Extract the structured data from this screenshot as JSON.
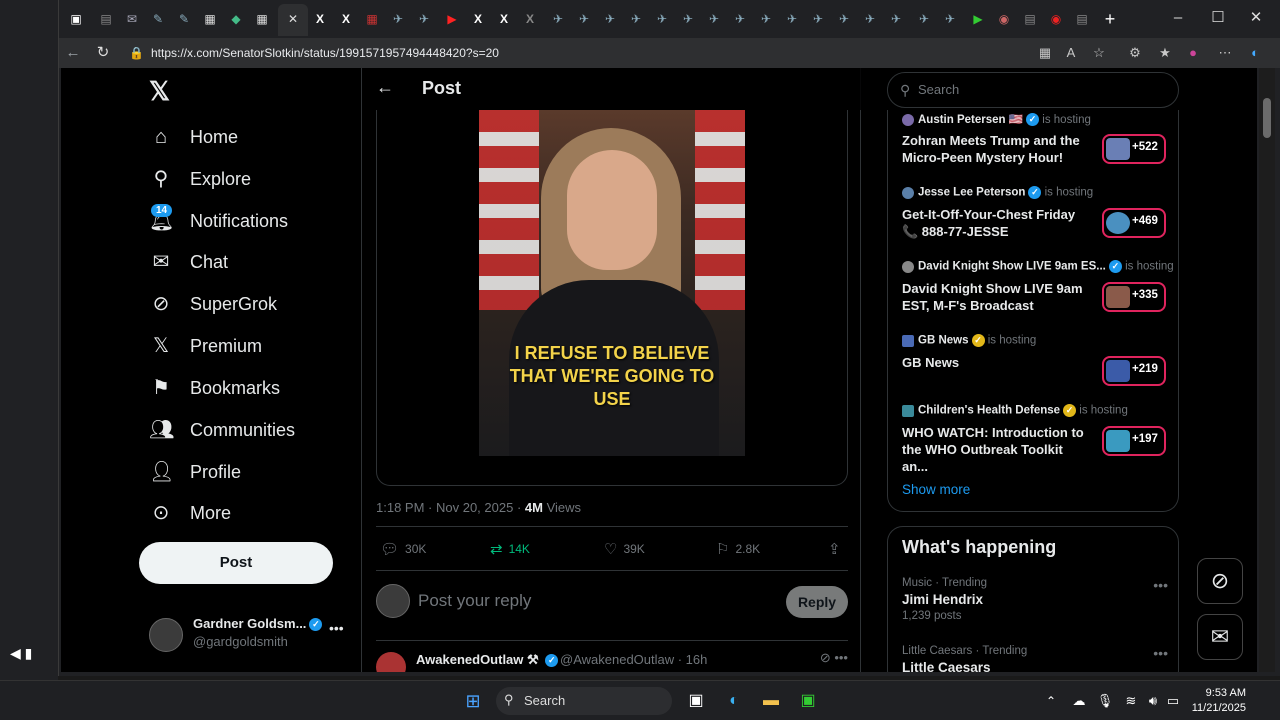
{
  "browser": {
    "url": "https://x.com/SenatorSlotkin/status/1991571957494448420?s=20"
  },
  "nav": {
    "items": [
      {
        "label": "Home",
        "icon": "home-icon"
      },
      {
        "label": "Explore",
        "icon": "search-icon"
      },
      {
        "label": "Notifications",
        "icon": "bell-icon"
      },
      {
        "label": "Chat",
        "icon": "mail-icon"
      },
      {
        "label": "SuperGrok",
        "icon": "grok-icon"
      },
      {
        "label": "Premium",
        "icon": "x-icon"
      },
      {
        "label": "Bookmarks",
        "icon": "bookmark-icon"
      },
      {
        "label": "Communities",
        "icon": "people-icon"
      },
      {
        "label": "Profile",
        "icon": "user-icon"
      },
      {
        "label": "More",
        "icon": "more-circle-icon"
      }
    ],
    "notifications_badge": "14",
    "post_button": "Post",
    "account": {
      "name": "Gardner Goldsm...",
      "handle": "@gardgoldsmith"
    }
  },
  "post": {
    "header_title": "Post",
    "video_caption": "I REFUSE TO BELIEVE THAT WE'RE GOING TO USE",
    "time": "1:18 PM",
    "date": "Nov 20, 2025",
    "views_count": "4M",
    "views_label": "Views",
    "actions": {
      "replies": "30K",
      "reposts": "14K",
      "likes": "39K",
      "bookmarks": "2.8K"
    },
    "reply_placeholder": "Post your reply",
    "reply_button": "Reply",
    "comment": {
      "name": "AwakenedOutlaw",
      "handle": "@AwakenedOutlaw · 16h"
    }
  },
  "sidebar": {
    "search_placeholder": "Search",
    "spaces": [
      {
        "host": "Austin Petersen",
        "hosting": "is hosting",
        "title": "Zohran Meets Trump and the Micro-Peen Mystery Hour!",
        "count": "+522"
      },
      {
        "host": "Jesse Lee Peterson",
        "hosting": "is hosting",
        "title": "Get-It-Off-Your-Chest Friday 📞 888-77-JESSE",
        "count": "+469"
      },
      {
        "host": "David Knight Show LIVE 9am ES...",
        "hosting": "is hosting",
        "title": "David Knight Show LIVE 9am EST, M-F's Broadcast",
        "count": "+335"
      },
      {
        "host": "GB News",
        "hosting": "is hosting",
        "title": "GB News",
        "count": "+219"
      },
      {
        "host": "Children's Health Defense",
        "hosting": "is hosting",
        "title": "WHO WATCH: Introduction to the WHO Outbreak Toolkit an...",
        "count": "+197"
      }
    ],
    "show_more": "Show more",
    "happening_title": "What's happening",
    "trends": [
      {
        "context": "Music · Trending",
        "name": "Jimi Hendrix",
        "posts": "1,239 posts"
      },
      {
        "context": "Little Caesars · Trending",
        "name": "Little Caesars",
        "posts": ""
      }
    ]
  },
  "taskbar": {
    "search_label": "Search",
    "time": "9:53 AM",
    "date": "11/21/2025"
  }
}
